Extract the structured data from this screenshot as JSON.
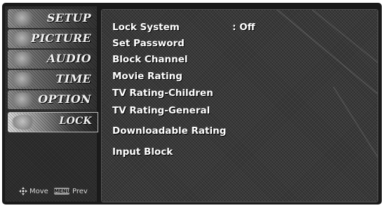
{
  "menu": {
    "items": [
      {
        "label": "SETUP"
      },
      {
        "label": "PICTURE"
      },
      {
        "label": "AUDIO"
      },
      {
        "label": "TIME"
      },
      {
        "label": "OPTION"
      },
      {
        "label": "LOCK"
      }
    ],
    "active": "LOCK"
  },
  "footer": {
    "move_label": "Move",
    "menu_key": "MENU",
    "prev_label": "Prev"
  },
  "lock_panel": {
    "options": [
      {
        "label": "Lock System",
        "value": ": Off"
      },
      {
        "label": "Set Password"
      },
      {
        "label": "Block Channel"
      },
      {
        "label": "Movie Rating"
      },
      {
        "label": "TV Rating-Children"
      },
      {
        "label": "TV Rating-General"
      },
      {
        "label": "Downloadable Rating"
      },
      {
        "label": "Input Block"
      }
    ]
  }
}
